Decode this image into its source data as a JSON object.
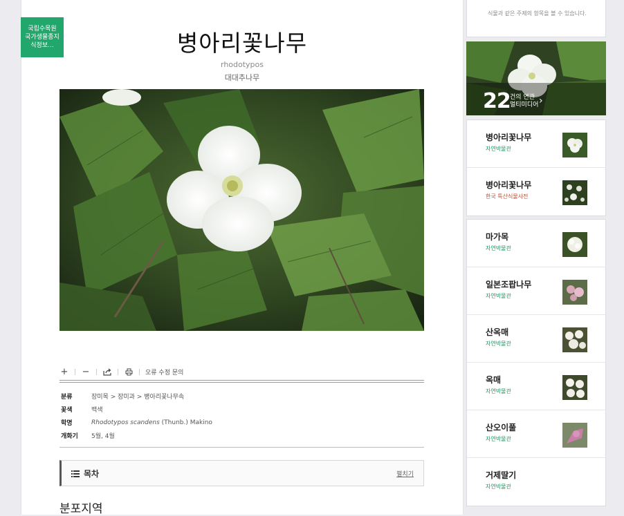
{
  "source_badge": {
    "line1": "국립수목원",
    "line2": "국가생물종지",
    "line3": "식정보..."
  },
  "article": {
    "title": "병아리꽃나무",
    "scientific_short": "rhodotypos",
    "alias": "대대추나무"
  },
  "toolbar": {
    "zoom_in_icon": "plus-icon",
    "zoom_out_icon": "minus-icon",
    "share_icon": "share-icon",
    "print_icon": "print-icon",
    "report_label": "오류 수정 문의"
  },
  "info": {
    "rows": [
      {
        "key": "분류",
        "value": "장미목 > 장미과 > 병아리꽃나무속"
      },
      {
        "key": "꽃색",
        "value": "백색"
      },
      {
        "key": "학명",
        "value_italic": "Rhodotypos scandens",
        "value_rest": " (Thunb.) Makino"
      },
      {
        "key": "개화기",
        "value": "5월, 4월"
      }
    ]
  },
  "toc": {
    "title": "목차",
    "expand": "펼치기"
  },
  "section_heading": "분포지역",
  "sidebar": {
    "top_text": "식물과 같은 주제의 항목을 볼 수 있습니다.",
    "media": {
      "count": "22",
      "label1": "건의 연관",
      "label2": "멀티미디어"
    },
    "group1": [
      {
        "name": "병아리꽃나무",
        "source": "자연박물관",
        "source_color": "green"
      },
      {
        "name": "병아리꽃나무",
        "source": "한국 특산식물사전",
        "source_color": "red"
      }
    ],
    "group2": [
      {
        "name": "마가목",
        "source": "자연박물관"
      },
      {
        "name": "일본조팝나무",
        "source": "자연박물관"
      },
      {
        "name": "산옥매",
        "source": "자연박물관"
      },
      {
        "name": "옥매",
        "source": "자연박물관"
      },
      {
        "name": "산오이풀",
        "source": "자연박물관"
      },
      {
        "name": "거제딸기",
        "source": "자연박물관"
      }
    ]
  },
  "colors": {
    "accent_green": "#21a66b",
    "source_green": "#1f9a60",
    "source_red": "#c44a2c"
  }
}
